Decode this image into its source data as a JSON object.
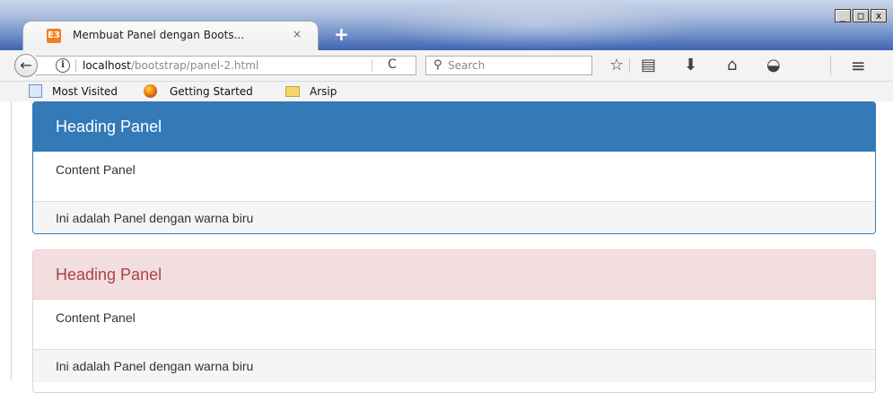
{
  "window": {
    "minimize_label": "_",
    "maximize_label": "□",
    "close_label": "x"
  },
  "tab": {
    "favicon_text": "E3",
    "title": "Membuat Panel dengan Boots...",
    "close_label": "×",
    "new_tab_label": "+"
  },
  "navbar": {
    "back_label": "←",
    "info_label": "i",
    "url_host": "localhost",
    "url_path": "/bootstrap/panel-2.html",
    "reload_label": "C",
    "search_icon": "⚲",
    "search_placeholder": "Search",
    "star_icon": "☆",
    "reading_list_icon": "▤",
    "download_icon": "⬇",
    "home_icon": "⌂",
    "pocket_icon": "◒",
    "menu_icon": "≡"
  },
  "bookmarks": [
    {
      "label": "Most Visited"
    },
    {
      "label": "Getting Started"
    },
    {
      "label": "Arsip"
    }
  ],
  "panels": [
    {
      "style": "primary",
      "heading": "Heading Panel",
      "body": "Content Panel",
      "footer": "Ini adalah Panel dengan warna biru",
      "color": "#337ab7"
    },
    {
      "style": "danger",
      "heading": "Heading Panel",
      "body": "Content Panel",
      "footer": "Ini adalah Panel dengan warna biru",
      "color": "#f2dede"
    }
  ]
}
